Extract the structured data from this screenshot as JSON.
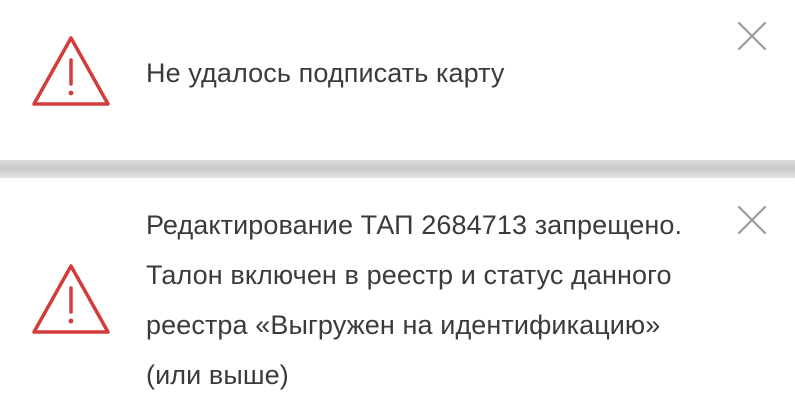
{
  "notifications": [
    {
      "type": "warning",
      "icon": "warning-triangle-icon",
      "message": "Не удалось подписать карту",
      "close_icon": "close-icon"
    },
    {
      "type": "warning",
      "icon": "warning-triangle-icon",
      "message": "Редактирование ТАП 2684713 запрещено. Талон включен в реестр и статус данного реестра «Выгружен на идентификацию» (или выше)",
      "close_icon": "close-icon"
    }
  ],
  "colors": {
    "warning": "#d23c3c",
    "close": "#9a9a9a",
    "text": "#3b3b3b",
    "separator": "#cfcfcf"
  }
}
